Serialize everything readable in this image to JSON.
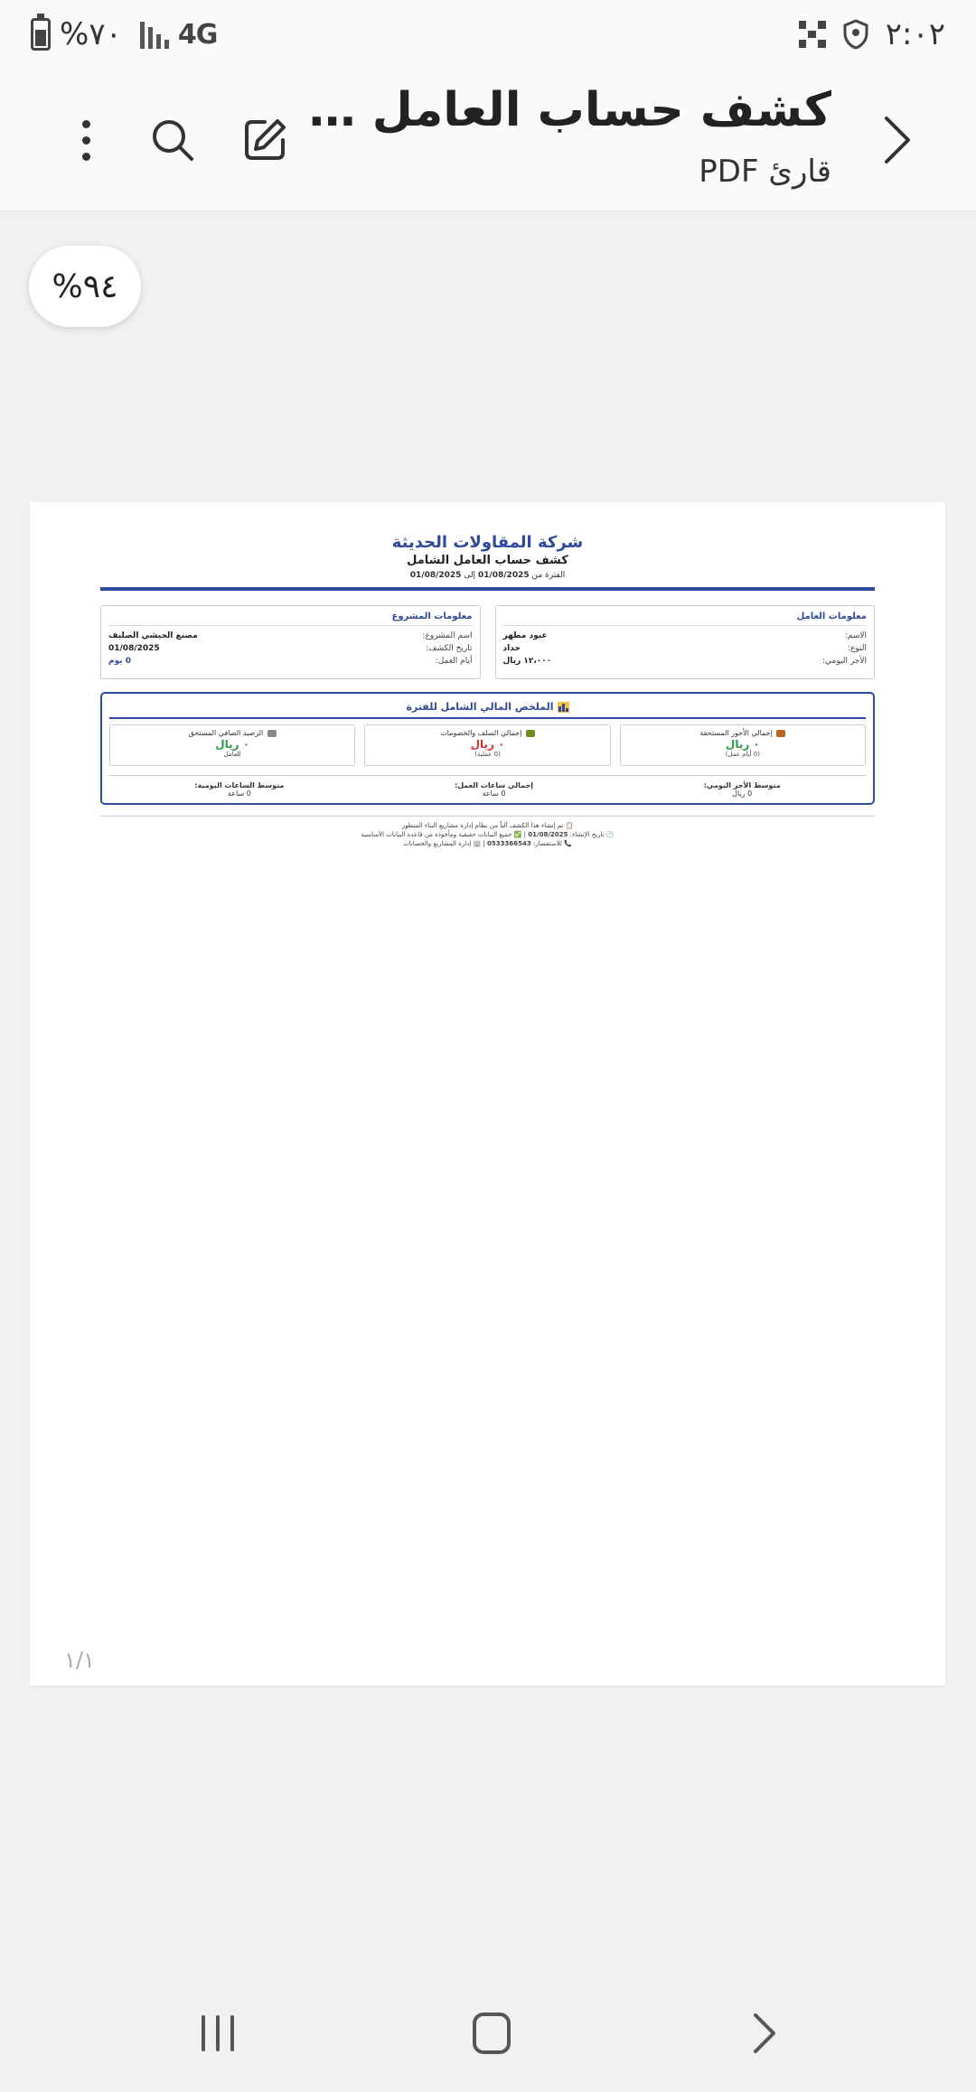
{
  "status": {
    "battery_percent": "%٧٠",
    "network": "4G",
    "time": "٢:٠٢"
  },
  "app": {
    "title": "كشف حساب العامل - عبود مطهر",
    "subtitle": "قارئ PDF"
  },
  "zoom": "%٩٤",
  "pdf": {
    "company": "شركة المقاولات الحديثة",
    "title": "كشف حساب العامل الشامل",
    "period_prefix": "الفترة من",
    "period_from": "01/08/2025",
    "period_mid": "إلى",
    "period_to": "01/08/2025",
    "worker_box": {
      "heading": "معلومات العامل",
      "rows": [
        {
          "k": "الاسم:",
          "v": "عبود مطهر"
        },
        {
          "k": "النوع:",
          "v": "حداد"
        },
        {
          "k": "الأجر اليومي:",
          "v": "١٢،٠٠٠ ريال"
        }
      ]
    },
    "project_box": {
      "heading": "معلومات المشروع",
      "rows": [
        {
          "k": "اسم المشروع:",
          "v": "مصنع الحيشي الصليف"
        },
        {
          "k": "تاريخ الكشف:",
          "v": "01/08/2025"
        },
        {
          "k": "أيام العمل:",
          "v": "0 يوم"
        }
      ]
    },
    "summary": {
      "title": "الملخص المالي الشامل للفترة",
      "cards": [
        {
          "label": "إجمالي الأجور المستحقة",
          "value": "٠ ريال",
          "note": "(0 أيام عمل)",
          "color": "#2e9a4a",
          "icon_color": "#b5651d"
        },
        {
          "label": "إجمالي السلف والخصومات",
          "value": "٠ ريال",
          "note": "(0 عملية)",
          "color": "#dd3333",
          "icon_color": "#6b8e23"
        },
        {
          "label": "الرصيد الصافي المستحق",
          "value": "٠ ريال",
          "note": "للعامل",
          "color": "#2e9a4a",
          "icon_color": "#8a8a8a"
        }
      ],
      "stats": [
        {
          "label": "متوسط الأجر اليومي:",
          "value": "0 ريال"
        },
        {
          "label": "إجمالي ساعات العمل:",
          "value": "0 ساعة"
        },
        {
          "label": "متوسط الساعات اليومية:",
          "value": "0 ساعة"
        }
      ]
    },
    "footer": {
      "line1": "📋 تم إنشاء هذا الكشف آلياً من نظام إدارة مشاريع البناء المتطور",
      "line2_prefix": "🕐 تاريخ الإنشاء:",
      "line2_date": "01/08/2025",
      "line2_suffix": "| ✅ جميع البيانات حقيقية ومأخوذة من قاعدة البيانات الأساسية",
      "line3_prefix": "📞 للاستفسار:",
      "line3_phone": "0533366543",
      "line3_suffix": "| 🏢 إدارة المشاريع والحسابات"
    },
    "page_num": "١/١"
  }
}
